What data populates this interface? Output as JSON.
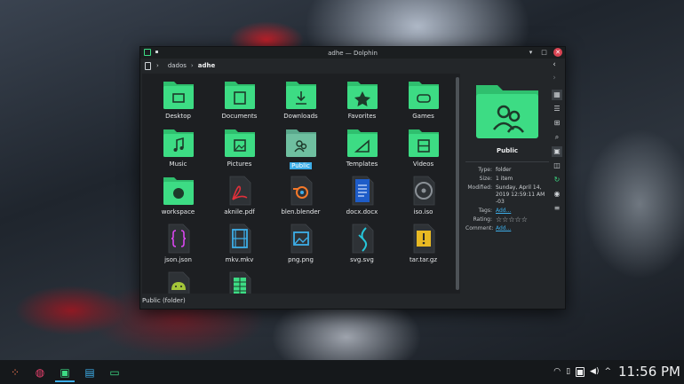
{
  "window": {
    "title": "adhe — Dolphin",
    "breadcrumb": [
      "dados",
      "adhe"
    ],
    "status_text": "Public (folder)"
  },
  "files": [
    {
      "label": "Desktop",
      "kind": "folder",
      "glyph": "desktop-icon"
    },
    {
      "label": "Documents",
      "kind": "folder",
      "glyph": "document-icon"
    },
    {
      "label": "Downloads",
      "kind": "folder",
      "glyph": "download-icon"
    },
    {
      "label": "Favorites",
      "kind": "folder",
      "glyph": "star-icon"
    },
    {
      "label": "Games",
      "kind": "folder",
      "glyph": "gamepad-icon"
    },
    {
      "label": "Music",
      "kind": "folder",
      "glyph": "music-icon"
    },
    {
      "label": "Pictures",
      "kind": "folder",
      "glyph": "picture-icon"
    },
    {
      "label": "Public",
      "kind": "folder",
      "glyph": "people-icon",
      "selected": true
    },
    {
      "label": "Templates",
      "kind": "folder",
      "glyph": "template-icon"
    },
    {
      "label": "Videos",
      "kind": "folder",
      "glyph": "film-icon"
    },
    {
      "label": "workspace",
      "kind": "folder",
      "glyph": "github-icon"
    },
    {
      "label": "aknile.pdf",
      "kind": "file",
      "glyph": "pdf-icon"
    },
    {
      "label": "blen.blender",
      "kind": "file",
      "glyph": "blender-icon"
    },
    {
      "label": "docx.docx",
      "kind": "file",
      "glyph": "docx-icon"
    },
    {
      "label": "iso.iso",
      "kind": "file",
      "glyph": "disc-icon"
    },
    {
      "label": "json.json",
      "kind": "file",
      "glyph": "json-icon"
    },
    {
      "label": "mkv.mkv",
      "kind": "file",
      "glyph": "mkv-icon"
    },
    {
      "label": "png.png",
      "kind": "file",
      "glyph": "image-file-icon"
    },
    {
      "label": "svg.svg",
      "kind": "file",
      "glyph": "svg-icon"
    },
    {
      "label": "tar.tar.gz",
      "kind": "file",
      "glyph": "archive-icon"
    },
    {
      "label": "",
      "kind": "file",
      "glyph": "android-icon"
    },
    {
      "label": "",
      "kind": "file",
      "glyph": "spreadsheet-icon"
    }
  ],
  "info": {
    "name": "Public",
    "rows": [
      {
        "key": "Type:",
        "value": "folder"
      },
      {
        "key": "Size:",
        "value": "1 item"
      },
      {
        "key": "Modified:",
        "value": "Sunday, April 14, 2019 12:59:11 AM -03"
      },
      {
        "key": "Tags:",
        "value": "Add...",
        "link": true
      },
      {
        "key": "Rating:",
        "value": "☆☆☆☆☆",
        "stars": true
      },
      {
        "key": "Comment:",
        "value": "Add...",
        "link": true
      }
    ]
  },
  "taskbar": {
    "clock": "11:56 PM",
    "tray_up": "^"
  },
  "colors": {
    "folder": "#3ddc84",
    "folder_tab": "#2fbf6e",
    "accent": "#3daee9",
    "close": "#da4453"
  }
}
